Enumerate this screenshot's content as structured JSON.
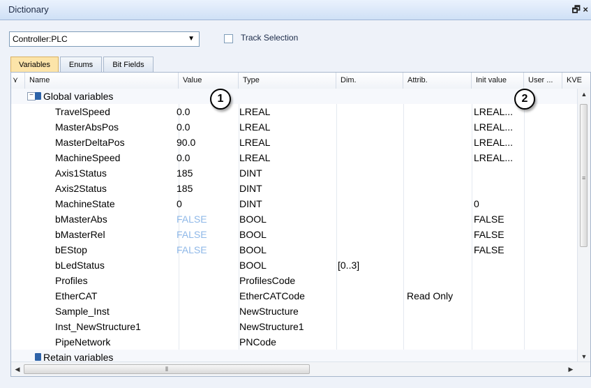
{
  "window": {
    "title": "Dictionary",
    "buttons": "🗗 ×"
  },
  "toolbar": {
    "controller": "Controller:PLC",
    "track_selection": "Track Selection"
  },
  "tabs": [
    {
      "label": "Variables",
      "active": true
    },
    {
      "label": "Enums",
      "active": false
    },
    {
      "label": "Bit Fields",
      "active": false
    }
  ],
  "columns": {
    "name": "Name",
    "value": "Value",
    "type": "Type",
    "dim": "Dim.",
    "attrib": "Attrib.",
    "init": "Init value",
    "user": "User ...",
    "kve": "KVE"
  },
  "groups": {
    "global": "Global variables",
    "retain": "Retain variables"
  },
  "rows": [
    {
      "name": "TravelSpeed",
      "value": "0.0",
      "type": "LREAL",
      "dim": "",
      "attrib": "",
      "init": "LREAL...",
      "value_color": "#000000"
    },
    {
      "name": "MasterAbsPos",
      "value": "0.0",
      "type": "LREAL",
      "dim": "",
      "attrib": "",
      "init": "LREAL...",
      "value_color": "#000000"
    },
    {
      "name": "MasterDeltaPos",
      "value": "90.0",
      "type": "LREAL",
      "dim": "",
      "attrib": "",
      "init": "LREAL...",
      "value_color": "#000000"
    },
    {
      "name": "MachineSpeed",
      "value": "0.0",
      "type": "LREAL",
      "dim": "",
      "attrib": "",
      "init": "LREAL...",
      "value_color": "#000000"
    },
    {
      "name": "Axis1Status",
      "value": "185",
      "type": "DINT",
      "dim": "",
      "attrib": "",
      "init": "",
      "value_color": "#000000"
    },
    {
      "name": "Axis2Status",
      "value": "185",
      "type": "DINT",
      "dim": "",
      "attrib": "",
      "init": "",
      "value_color": "#000000"
    },
    {
      "name": "MachineState",
      "value": "0",
      "type": "DINT",
      "dim": "",
      "attrib": "",
      "init": "0",
      "value_color": "#000000"
    },
    {
      "name": "bMasterAbs",
      "value": "FALSE",
      "type": "BOOL",
      "dim": "",
      "attrib": "",
      "init": "FALSE",
      "value_color": "#8fb8e8"
    },
    {
      "name": "bMasterRel",
      "value": "FALSE",
      "type": "BOOL",
      "dim": "",
      "attrib": "",
      "init": "FALSE",
      "value_color": "#8fb8e8"
    },
    {
      "name": "bEStop",
      "value": "FALSE",
      "type": "BOOL",
      "dim": "",
      "attrib": "",
      "init": "FALSE",
      "value_color": "#8fb8e8"
    },
    {
      "name": "bLedStatus",
      "value": "",
      "type": "BOOL",
      "dim": "[0..3]",
      "attrib": "",
      "init": "",
      "value_color": "#000000"
    },
    {
      "name": "Profiles",
      "value": "",
      "type": "ProfilesCode",
      "dim": "",
      "attrib": "",
      "init": "",
      "value_color": "#000000"
    },
    {
      "name": "EtherCAT",
      "value": "",
      "type": "EtherCATCode",
      "dim": "",
      "attrib": "Read Only",
      "init": "",
      "value_color": "#000000"
    },
    {
      "name": "Sample_Inst",
      "value": "",
      "type": "NewStructure",
      "dim": "",
      "attrib": "",
      "init": "",
      "value_color": "#000000"
    },
    {
      "name": "Inst_NewStructure1",
      "value": "",
      "type": "NewStructure1",
      "dim": "",
      "attrib": "",
      "init": "",
      "value_color": "#000000"
    },
    {
      "name": "PipeNetwork",
      "value": "",
      "type": "PNCode",
      "dim": "",
      "attrib": "",
      "init": "",
      "value_color": "#000000"
    }
  ],
  "markers": [
    "1",
    "2"
  ],
  "icons": {
    "group": "database-icon",
    "dropdown": "chevron-down-icon"
  }
}
